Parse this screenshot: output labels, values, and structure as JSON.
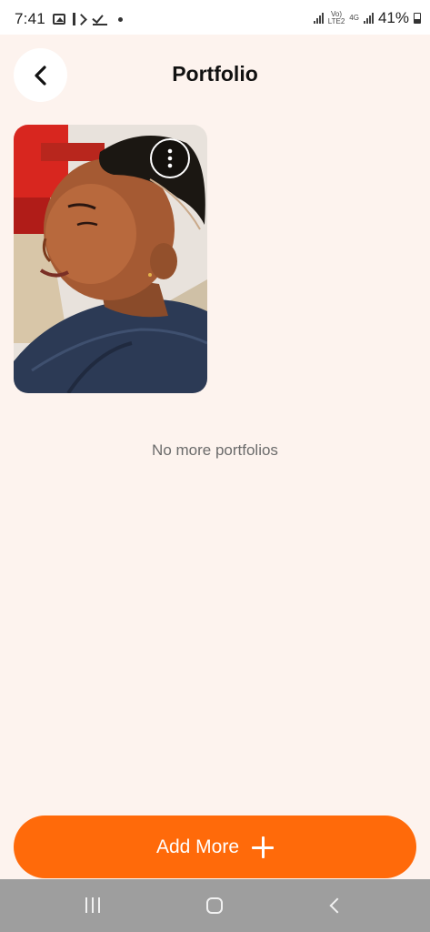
{
  "status_bar": {
    "time": "7:41",
    "network_label_1": "Vo)\nLTE2",
    "network_label_2": "4G",
    "battery_percent": "41%",
    "battery_level": 0.41
  },
  "header": {
    "title": "Portfolio",
    "back_icon": "chevron-left-icon"
  },
  "portfolio": {
    "items": [
      {
        "type": "photo",
        "description_icon": "more-vertical-icon"
      }
    ],
    "empty_message": "No more portfolios"
  },
  "actions": {
    "add_more_label": "Add More",
    "add_more_icon": "plus-icon"
  },
  "colors": {
    "background": "#fdf3ee",
    "accent": "#ff6a0a",
    "nav_bar": "#9e9e9e"
  }
}
